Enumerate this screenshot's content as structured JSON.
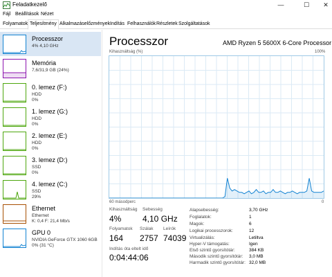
{
  "window": {
    "title": "Feladatkezelő",
    "min_glyph": "—",
    "max_glyph": "☐",
    "close_glyph": "✕"
  },
  "menu": [
    "Fájl",
    "Beállítások",
    "Nézet"
  ],
  "tabs": [
    "Folyamatok",
    "Teljesítmény",
    "Alkalmazáselőzmények",
    "Indítás",
    "Felhasználók",
    "Részletek",
    "Szolgáltatások"
  ],
  "active_tab": "Teljesítmény",
  "sidebar": {
    "items": [
      {
        "name": "Processzor",
        "l1": "4% 4,10 GHz",
        "l2": "",
        "color": "#1182d2",
        "icon": "cpu-graph-icon"
      },
      {
        "name": "Memória",
        "l1": "7,6/31,9 GB (24%)",
        "l2": "",
        "color": "#8b12ae",
        "icon": "memory-graph-icon"
      },
      {
        "name": "0. lemez (F:)",
        "l1": "HDD",
        "l2": "0%",
        "color": "#4da60c",
        "icon": "disk-graph-icon"
      },
      {
        "name": "1. lemez (G:)",
        "l1": "HDD",
        "l2": "0%",
        "color": "#4da60c",
        "icon": "disk-graph-icon"
      },
      {
        "name": "2. lemez (E:)",
        "l1": "HDD",
        "l2": "0%",
        "color": "#4da60c",
        "icon": "disk-graph-icon"
      },
      {
        "name": "3. lemez (D:)",
        "l1": "SSD",
        "l2": "0%",
        "color": "#4da60c",
        "icon": "disk-graph-icon"
      },
      {
        "name": "4. lemez (C:)",
        "l1": "SSD",
        "l2": "29%",
        "color": "#4da60c",
        "icon": "disk-graph-icon"
      },
      {
        "name": "Ethernet",
        "l1": "Ethernet",
        "l2": "K: 0,4 F: 21,4 Mb/s",
        "color": "#a74f01",
        "icon": "network-graph-icon"
      },
      {
        "name": "GPU 0",
        "l1": "NVIDIA GeForce GTX 1060 6GB",
        "l2": "0% (31 °C)",
        "color": "#1182d2",
        "icon": "gpu-graph-icon"
      }
    ]
  },
  "main": {
    "title": "Processzor",
    "model": "AMD Ryzen 5 5600X 6-Core Processor",
    "graph_label_left": "Kihasználtság (%)",
    "graph_label_right": "100%",
    "graph_bottom_left": "60 másodperc",
    "graph_bottom_right": "0"
  },
  "stats": {
    "utilization_label": "Kihasználtság",
    "utilization_value": "4%",
    "speed_label": "Sebesség",
    "speed_value": "4,10 GHz",
    "processes_label": "Folyamatok",
    "processes_value": "164",
    "threads_label": "Szálak",
    "threads_value": "2757",
    "handles_label": "Leírók",
    "handles_value": "74039",
    "uptime_label": "Indítás óta eltelt idő",
    "uptime_value": "0:04:44:06"
  },
  "details": [
    {
      "k": "Alapsebesség:",
      "v": "3,70 GHz"
    },
    {
      "k": "Foglalatok:",
      "v": "1"
    },
    {
      "k": "Magok:",
      "v": "6"
    },
    {
      "k": "Logikai processzorok:",
      "v": "12"
    },
    {
      "k": "Virtualizálás:",
      "v": "Letiltva"
    },
    {
      "k": "Hyper-V támogatás:",
      "v": "Igen"
    },
    {
      "k": "Első szintű gyorsítótár:",
      "v": "384 KB"
    },
    {
      "k": "Második szintű gyorsítótár:",
      "v": "3,0 MB"
    },
    {
      "k": "Harmadik szintű gyorsítótár:",
      "v": "32,0 MB"
    }
  ],
  "cpu_history_percent": [
    0,
    0,
    0,
    0,
    0,
    0,
    0,
    0,
    0,
    0,
    0,
    0,
    0,
    0,
    0,
    0,
    0,
    0,
    0,
    0,
    0,
    0,
    0,
    0,
    0,
    0,
    0,
    0,
    0,
    0,
    0,
    0,
    0,
    0,
    0,
    0,
    0,
    0,
    0,
    0,
    0,
    0,
    0,
    0,
    0,
    0,
    0,
    0,
    1,
    14,
    7,
    5,
    6,
    5,
    4,
    4,
    3,
    4,
    5,
    3,
    4,
    6,
    4,
    4,
    5,
    3,
    4,
    4,
    6,
    4,
    4,
    5,
    4,
    3,
    4,
    4,
    5,
    4,
    3,
    4,
    4,
    4,
    5,
    14,
    5,
    4,
    4,
    4,
    4,
    5
  ]
}
